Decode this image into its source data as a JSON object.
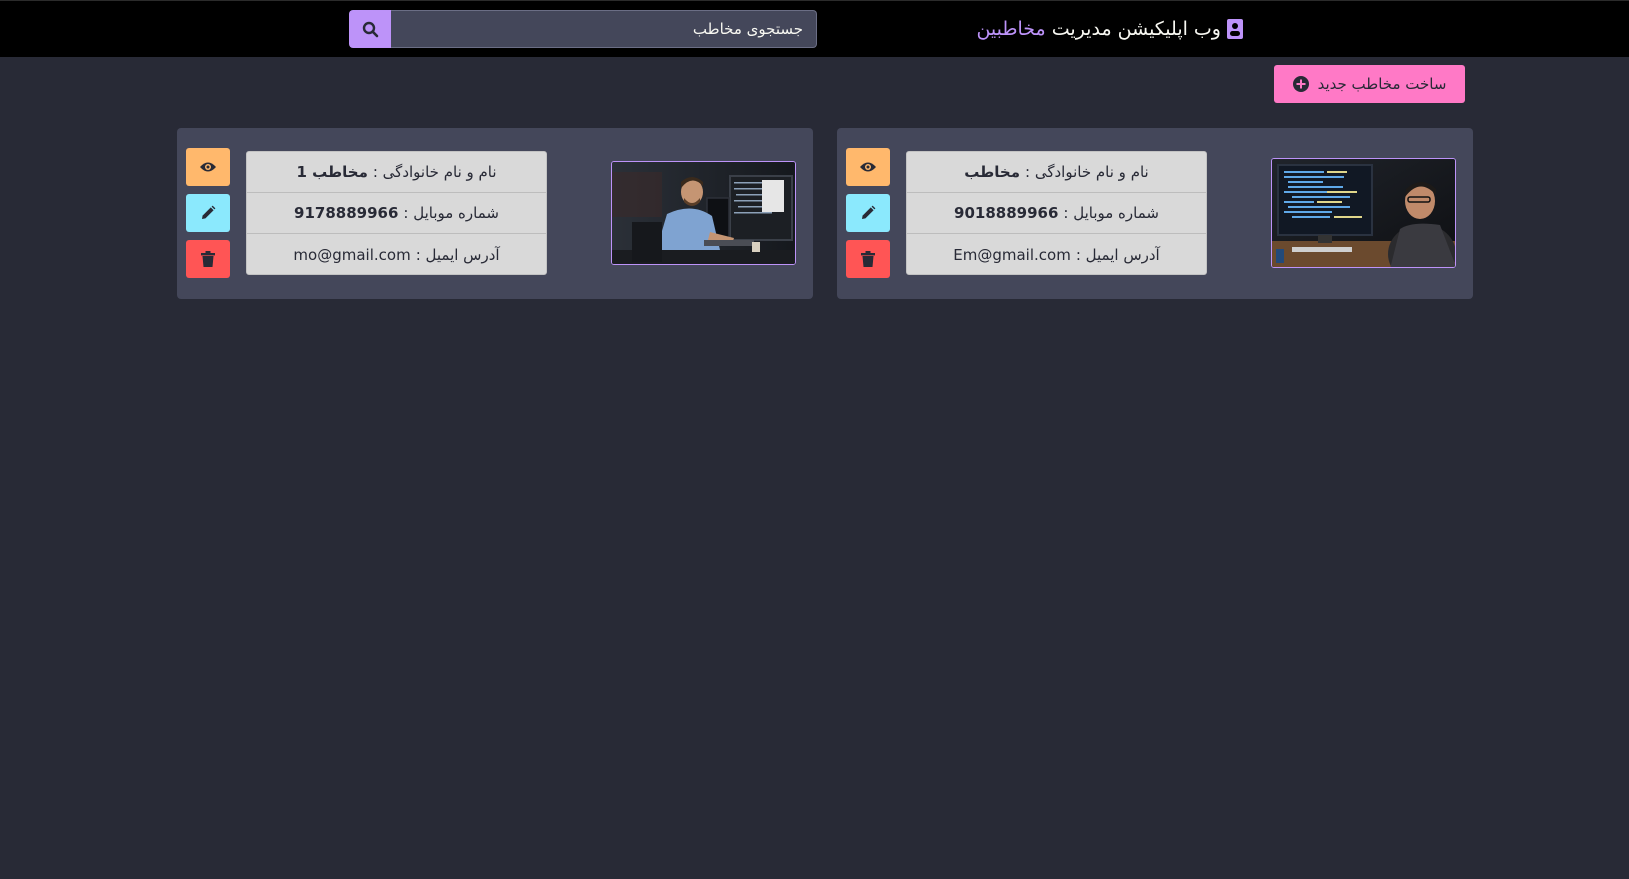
{
  "navbar": {
    "brand_prefix": "وب اپلیکیشن مدیریت",
    "brand_accent": "مخاطبین",
    "brand_icon": "address-card-icon",
    "search_placeholder": "جستجوی مخاطب",
    "search_icon": "search-icon"
  },
  "toolbar": {
    "new_contact_label": "ساخت مخاطب جدید",
    "new_contact_icon": "plus-circle-icon"
  },
  "contacts": [
    {
      "name_label": "نام و نام خانوادگی :",
      "name": "مخاطب",
      "mobile_label": "شماره موبایل :",
      "mobile": "9018889966",
      "email_label": "آدرس ایمیل :",
      "email": "Em@gmail.com",
      "photo": "developer-monitor-code-photo"
    },
    {
      "name_label": "نام و نام خانوادگی :",
      "name": "مخاطب 1",
      "mobile_label": "شماره موبایل :",
      "mobile": "9178889966",
      "email_label": "آدرس ایمیل :",
      "email": "mo@gmail.com",
      "photo": "developer-office-photo"
    }
  ],
  "actions": {
    "view_icon": "eye-icon",
    "edit_icon": "pencil-icon",
    "delete_icon": "trash-icon"
  },
  "colors": {
    "background": "#282a36",
    "card": "#44475a",
    "purple": "#bd93f9",
    "pink": "#ff79c6",
    "orange": "#ffb86c",
    "cyan": "#8be9fd",
    "red": "#ff5555"
  }
}
